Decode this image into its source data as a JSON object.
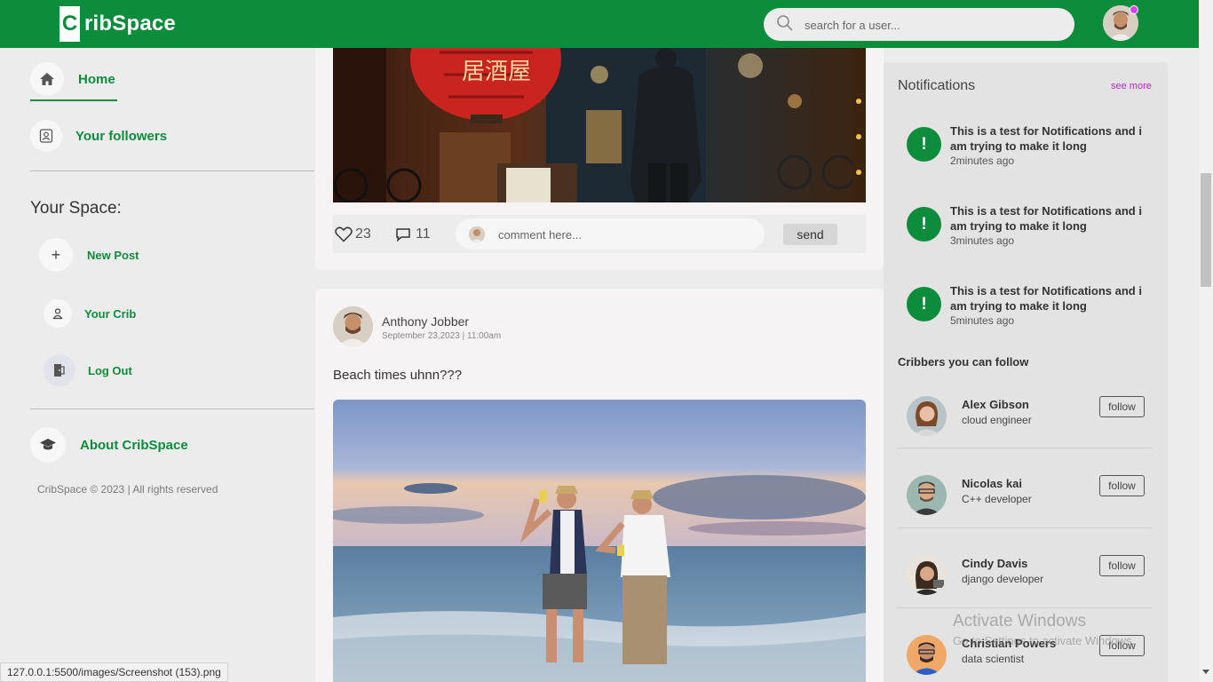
{
  "header": {
    "logo_letter": "C",
    "logo_text": "ribSpace",
    "search_placeholder": "search for a user..."
  },
  "sidebar": {
    "home_label": "Home",
    "followers_label": "Your followers",
    "space_title": "Your Space:",
    "new_post_label": "New Post",
    "new_post_symbol": "+",
    "your_crib_label": "Your Crib",
    "log_out_label": "Log Out",
    "about_label": "About CribSpace",
    "copyright": "CribSpace © 2023 | All rights reserved"
  },
  "feed": {
    "post1": {
      "likes": "23",
      "comments": "11",
      "comment_placeholder": "comment here...",
      "send_label": "send"
    },
    "post2": {
      "author": "Anthony Jobber",
      "date": "September 23,2023 | 11:00am",
      "text": "Beach times uhnn???"
    }
  },
  "notifications": {
    "title": "Notifications",
    "see_more": "see more",
    "items": [
      {
        "icon": "!",
        "text": "This is a test for Notifications and i am trying to make it long",
        "time": "2minutes ago"
      },
      {
        "icon": "!",
        "text": "This is a test for Notifications and i am trying to make it long",
        "time": "3minutes ago"
      },
      {
        "icon": "!",
        "text": "This is a test for Notifications and i am trying to make it long",
        "time": "5minutes ago"
      }
    ]
  },
  "suggestions": {
    "title": "Cribbers you can follow",
    "items": [
      {
        "name": "Alex Gibson",
        "role": "cloud engineer",
        "button": "follow"
      },
      {
        "name": "Nicolas kai",
        "role": "C++ developer",
        "button": "follow"
      },
      {
        "name": "Cindy Davis",
        "role": "django developer",
        "button": "follow"
      },
      {
        "name": "Christian Powers",
        "role": "data scientist",
        "button": "follow"
      }
    ]
  },
  "overlays": {
    "status_url": "127.0.0.1:5500/images/Screenshot (153).png",
    "watermark_title": "Activate Windows",
    "watermark_sub": "Go to Settings to activate Windows."
  },
  "colors": {
    "brand_green": "#0d8c3c",
    "see_more": "#c020d0",
    "notification_dot": "#e040fb"
  }
}
